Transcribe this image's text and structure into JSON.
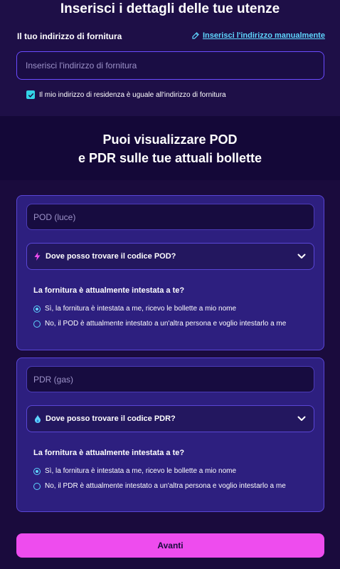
{
  "header": {
    "title": "Inserisci i dettagli delle tue utenze"
  },
  "address": {
    "label": "Il tuo indirizzo di fornitura",
    "manual_link": "Inserisci l'indirizzo manualmente",
    "placeholder": "Inserisci l'indirizzo di fornitura",
    "value": "",
    "same_residence_label": "Il mio indirizzo di residenza è uguale all'indirizzo di fornitura",
    "same_residence_checked": true
  },
  "info_band": {
    "line1": "Puoi visualizzare POD",
    "line2": "e PDR sulle tue attuali bollette"
  },
  "pod_card": {
    "input_placeholder": "POD (luce)",
    "input_value": "",
    "accordion_label": "Dove posso trovare il codice POD?",
    "accordion_icon": "lightning-icon",
    "question": "La fornitura è attualmente intestata a te?",
    "option_yes": "Sì, la fornitura è intestata a me, ricevo le bollette a mio nome",
    "option_no": "No, il POD è attualmente intestato a un'altra persona e voglio intestarlo a me",
    "selected": "yes"
  },
  "pdr_card": {
    "input_placeholder": "PDR (gas)",
    "input_value": "",
    "accordion_label": "Dove posso trovare il codice PDR?",
    "accordion_icon": "flame-drop-icon",
    "question": "La fornitura è attualmente intestata a te?",
    "option_yes": "Sì, la fornitura è intestata a me, ricevo le bollette a mio nome",
    "option_no": "No, il PDR è attualmente intestato a un'altra persona e voglio intestarlo a me",
    "selected": "yes"
  },
  "footer": {
    "next_label": "Avanti"
  },
  "colors": {
    "background": "#1a0b3d",
    "card": "#2d1f7f",
    "accent_cyan": "#5fd6ff",
    "button_pink": "#ee4cee",
    "input_border": "#6a4bff"
  }
}
